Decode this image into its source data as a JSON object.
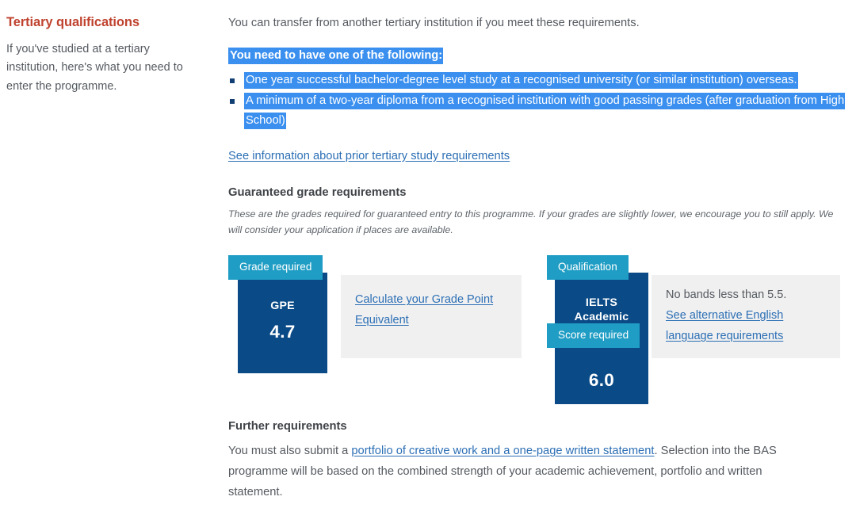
{
  "sidebar": {
    "title": "Tertiary qualifications",
    "description": "If you've studied at a tertiary institution, here's what you need to enter the programme."
  },
  "main": {
    "intro": "You can transfer from another tertiary institution if you meet these requirements.",
    "need_heading": "You need to have one of the following:",
    "requirements": [
      "One year successful bachelor-degree level study at a recognised university (or similar institution) overseas.",
      "A minimum of a two-year diploma from a recognised institution with good passing grades (after graduation from High School)"
    ],
    "prior_study_link": "See information about prior tertiary study requirements",
    "guaranteed_heading": "Guaranteed grade requirements",
    "guaranteed_note": "These are the grades required for guaranteed entry to this programme. If your grades are slightly lower, we encourage you to still apply. We will consider your application if places are available."
  },
  "cards": {
    "gpe": {
      "tag": "Grade required",
      "label": "GPE",
      "value": "4.7",
      "panel_link": "Calculate your Grade Point Equivalent"
    },
    "ielts": {
      "tag_qualification": "Qualification",
      "label_line1": "IELTS",
      "label_line2": "Academic",
      "tag_score": "Score required",
      "value": "6.0",
      "panel_note": "No bands less than 5.5.",
      "panel_link": "See alternative English language requirements"
    }
  },
  "further": {
    "heading": "Further requirements",
    "body_before": "You must also submit a ",
    "link": "portfolio of creative work and a one-page written statement",
    "body_after": ". Selection into the BAS programme will be based on the combined strength of your academic achievement, portfolio and written statement."
  },
  "colors": {
    "heading_red": "#c0432f",
    "highlight_blue": "#3a8fef",
    "navy": "#0a4a86",
    "teal": "#1f9dc4",
    "link_blue": "#2c6fb5",
    "panel_grey": "#f0f0f0"
  }
}
